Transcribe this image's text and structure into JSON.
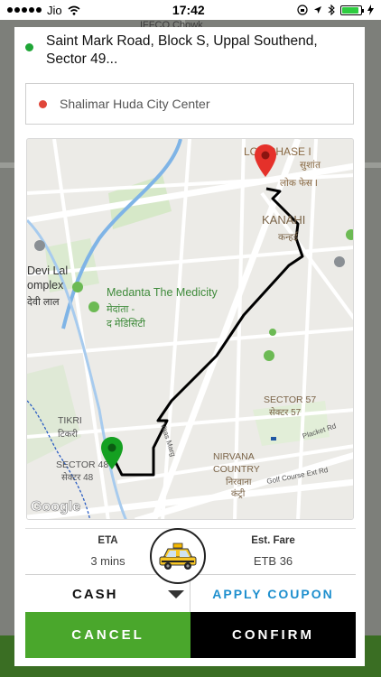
{
  "status_bar": {
    "carrier": "Jio",
    "time": "17:42"
  },
  "background": {
    "top_label": "IFFCO Chowk"
  },
  "pickup": {
    "address": "Saint Mark Road, Block S, Uppal Southend, Sector 49..."
  },
  "destination": {
    "address": "Shalimar Huda City Center"
  },
  "map": {
    "labels": {
      "phase1_a": "LOK PHASE I",
      "phase1_b": "सुशांत",
      "phase1_c": "लोक फेस I",
      "kanahi": "KANAHI",
      "kanahi_hi": "कन्हई",
      "devi_a": "Devi Lal",
      "devi_b": "omplex",
      "devi_c": "देवी लाल",
      "medanta": "Medanta The Medicity",
      "medanta_hi1": "मेदांता -",
      "medanta_hi2": "द मेडिसिटी",
      "sector57": "SECTOR 57",
      "sector57_hi": "सेक्टर 57",
      "tikri": "TIKRI",
      "tikri_hi": "टिकरी",
      "sector48": "SECTOR 48",
      "sector48_hi": "सेक्टर 48",
      "nirvana1": "NIRVANA",
      "nirvana2": "COUNTRY",
      "nirvana_hi1": "निरवाना",
      "nirvana_hi2": "कंट्री",
      "placket": "Placket Rd",
      "golf": "Golf Course Ext Rd",
      "vaas": "Vaas Marg",
      "google": "Google"
    }
  },
  "trip": {
    "eta_title": "ETA",
    "eta_value": "3 mins",
    "fare_title": "Est. Fare",
    "fare_value": "ETB 36"
  },
  "payment": {
    "method": "CASH",
    "coupon": "APPLY COUPON"
  },
  "actions": {
    "cancel": "CANCEL",
    "confirm": "CONFIRM"
  },
  "colors": {
    "cancel_bg": "#4aa72c",
    "confirm_bg": "#000000",
    "coupon_text": "#1e8fce",
    "route": "#000000",
    "pickup_dot": "#1fa637",
    "dest_dot": "#e0463a"
  },
  "icons": [
    "signal-icon",
    "wifi-icon",
    "battery-icon",
    "bluetooth-icon",
    "taxi-icon",
    "caret-down-icon",
    "pin-icon"
  ]
}
